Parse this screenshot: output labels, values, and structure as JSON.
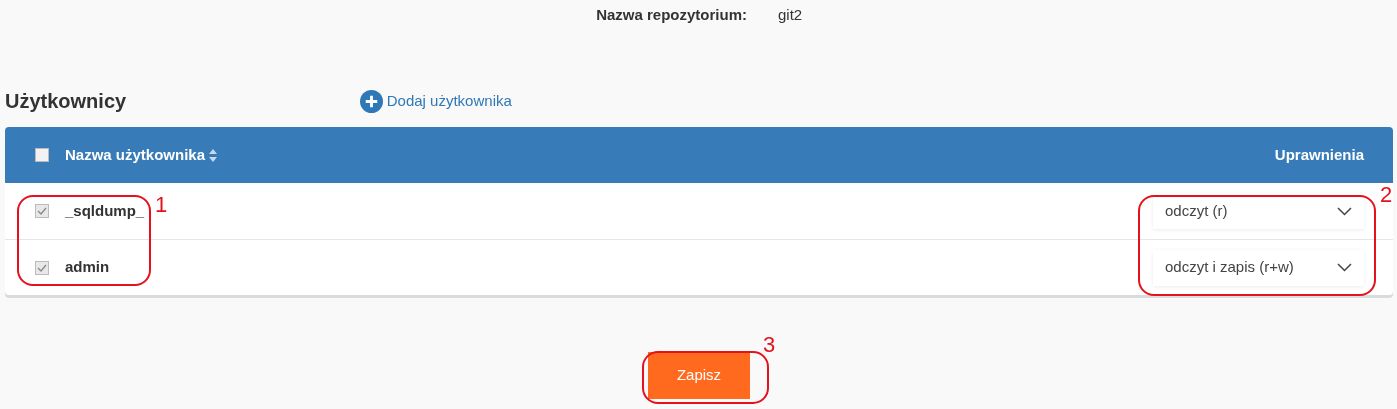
{
  "repository": {
    "label": "Nazwa repozytorium:",
    "value": "git2"
  },
  "users_section": {
    "title": "Użytkownicy",
    "add_link": "Dodaj użytkownika"
  },
  "table": {
    "select_all_checked": false,
    "columns": [
      {
        "label": "Nazwa użytkownika",
        "sortable": true
      },
      {
        "label": "Uprawnienia",
        "sortable": false
      }
    ],
    "rows": [
      {
        "checked": true,
        "name": "_sqldump_",
        "permission": "odczyt (r)"
      },
      {
        "checked": true,
        "name": "admin",
        "permission": "odczyt i zapis (r+w)"
      }
    ]
  },
  "save_button": "Zapisz",
  "annotations": [
    {
      "label": "1"
    },
    {
      "label": "2"
    },
    {
      "label": "3"
    }
  ]
}
